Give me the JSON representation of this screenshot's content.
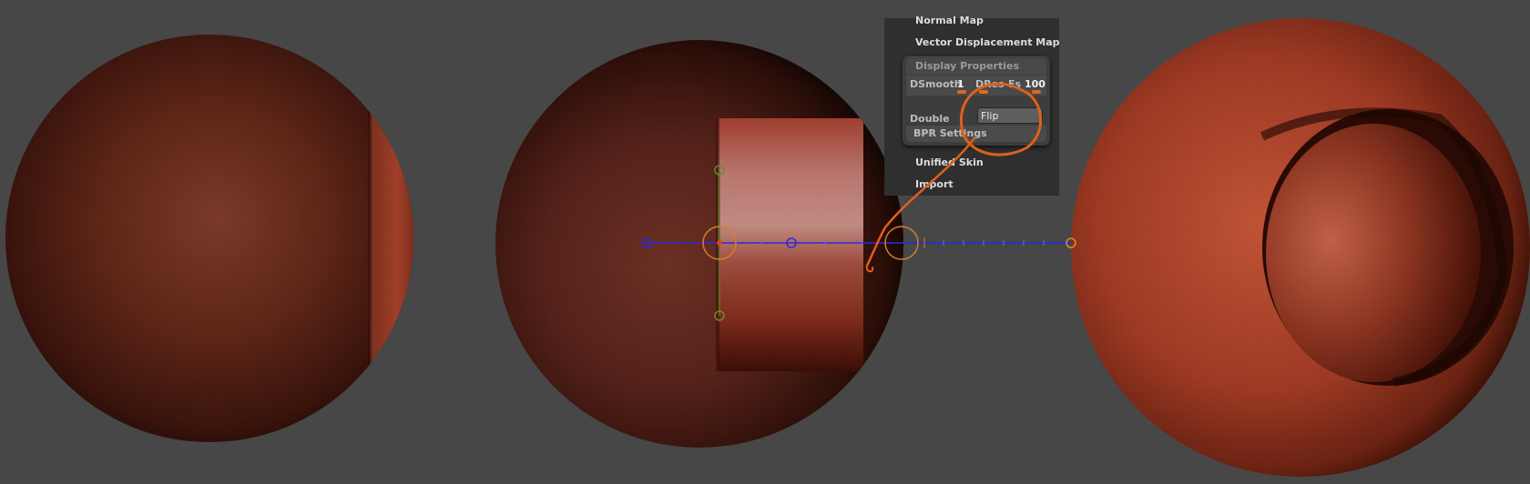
{
  "menu": {
    "normal_map": "Normal Map",
    "vector_displacement_map": "Vector Displacement Map",
    "unified_skin": "Unified Skin",
    "import": "Import"
  },
  "display_properties": {
    "header": "Display Properties",
    "dsmooth_label": "DSmooth",
    "dsmooth_value": "1",
    "dres_label": "DRes",
    "es_label": "Es",
    "es_value": "100",
    "double_label": "Double",
    "flip_label": "Flip",
    "bpr_settings": "BPR Settings"
  },
  "colors": {
    "background": "#474747",
    "sphere_base": "#8a3420",
    "annotation": "#e0601a",
    "transpose_line": "#2a2ad8"
  },
  "icons": {
    "transpose_action_line": "transpose-line-icon",
    "annotation_circle": "annotation-circle-icon"
  }
}
